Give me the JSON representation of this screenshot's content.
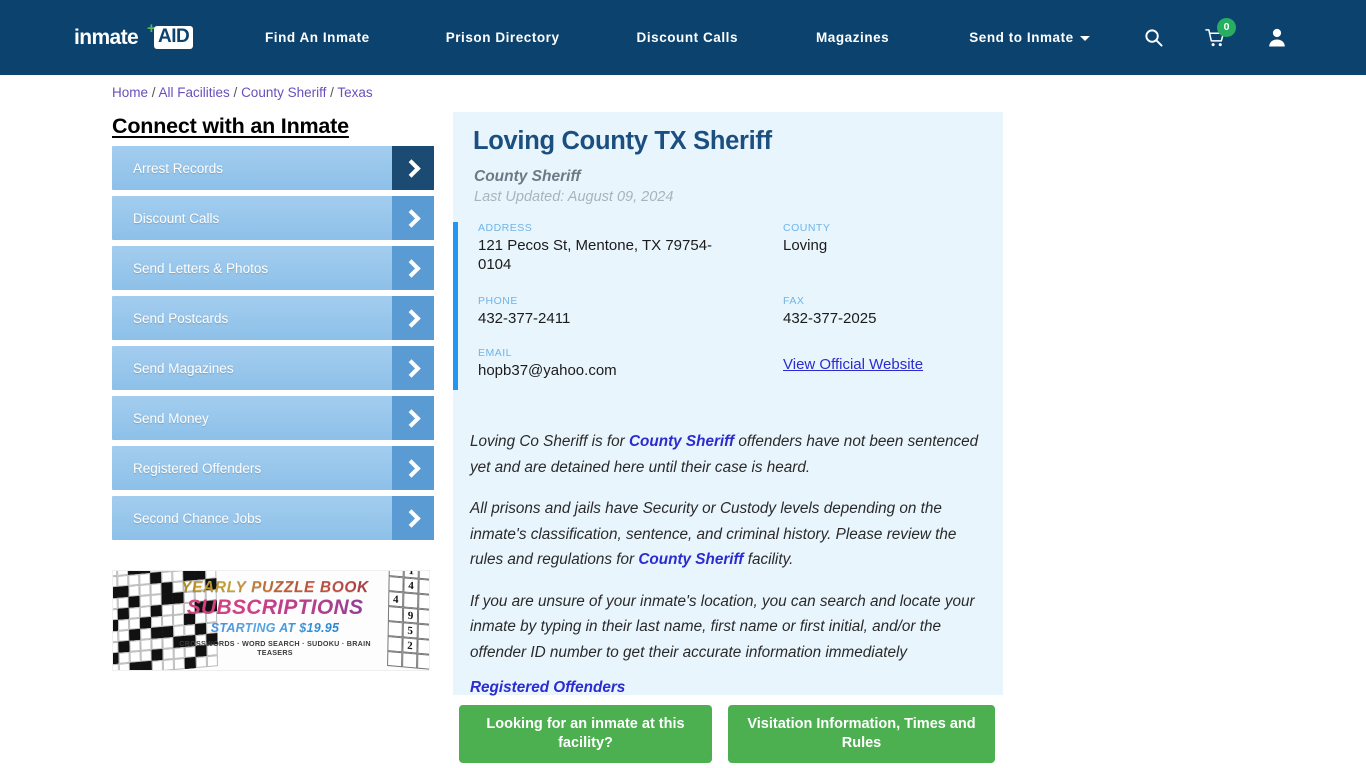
{
  "nav": {
    "logo": {
      "text": "inmate",
      "badge_text": "AID",
      "plus": "+"
    },
    "links": [
      {
        "label": "Find An Inmate"
      },
      {
        "label": "Prison Directory"
      },
      {
        "label": "Discount Calls"
      },
      {
        "label": "Magazines"
      },
      {
        "label": "Send to Inmate"
      }
    ],
    "icons": {
      "search": "search-icon",
      "cart": "cart-icon",
      "cart_badge": "0",
      "account": "user-icon"
    },
    "background_color": "#0c436e"
  },
  "breadcrumb": {
    "items": [
      "Home",
      "All Facilities",
      "County Sheriff",
      "Texas"
    ],
    "separator": "/",
    "link_color": "#6a4fbb"
  },
  "sidebar": {
    "title": "Connect with an Inmate",
    "items": [
      {
        "label": "Arrest Records",
        "active": true
      },
      {
        "label": "Discount Calls",
        "active": false
      },
      {
        "label": "Send Letters & Photos",
        "active": false
      },
      {
        "label": "Send Postcards",
        "active": false
      },
      {
        "label": "Send Magazines",
        "active": false
      },
      {
        "label": "Send Money",
        "active": false
      },
      {
        "label": "Registered Offenders",
        "active": false
      },
      {
        "label": "Second Chance Jobs",
        "active": false
      }
    ]
  },
  "ad": {
    "line1": "YEARLY PUZZLE BOOK",
    "line2": "SUBSCRIPTIONS",
    "line3": "STARTING AT $19.95",
    "line4": "CROSSWORDS · WORD SEARCH · SUDOKU · BRAIN TEASERS",
    "sudoku_digits": [
      "1",
      "4",
      "4",
      "9",
      "5",
      "2"
    ]
  },
  "facility": {
    "title": "Loving County TX Sheriff",
    "type": "County Sheriff",
    "last_updated": "Last Updated: August 09, 2024",
    "info": {
      "address_label": "ADDRESS",
      "address_value": "121 Pecos St, Mentone, TX 79754-0104",
      "county_label": "COUNTY",
      "county_value": "Loving",
      "phone_label": "PHONE",
      "phone_value": "432-377-2411",
      "fax_label": "FAX",
      "fax_value": "432-377-2025",
      "email_label": "EMAIL",
      "email_value": "hopb37@yahoo.com",
      "website_link": "View Official Website"
    },
    "paragraphs": {
      "p1_a": "Loving Co Sheriff is for ",
      "p1_link": "County Sheriff",
      "p1_b": " offenders have not been sentenced yet and are detained here until their case is heard.",
      "p2_a": "All prisons and jails have Security or Custody levels depending on the inmate's classification, sentence, and criminal history. Please review the rules and regulations for ",
      "p2_link": "County Sheriff",
      "p2_b": " facility.",
      "p3": "If you are unsure of your inmate's location, you can search and locate your inmate by typing in their last name, first name or first initial, and/or the offender ID number to get their accurate information immediately",
      "p3_link": "Registered Offenders"
    }
  },
  "buttons": {
    "find_inmate": "Looking for an inmate at this facility?",
    "visitation": "Visitation Information, Times and Rules",
    "color": "#4caf50"
  }
}
